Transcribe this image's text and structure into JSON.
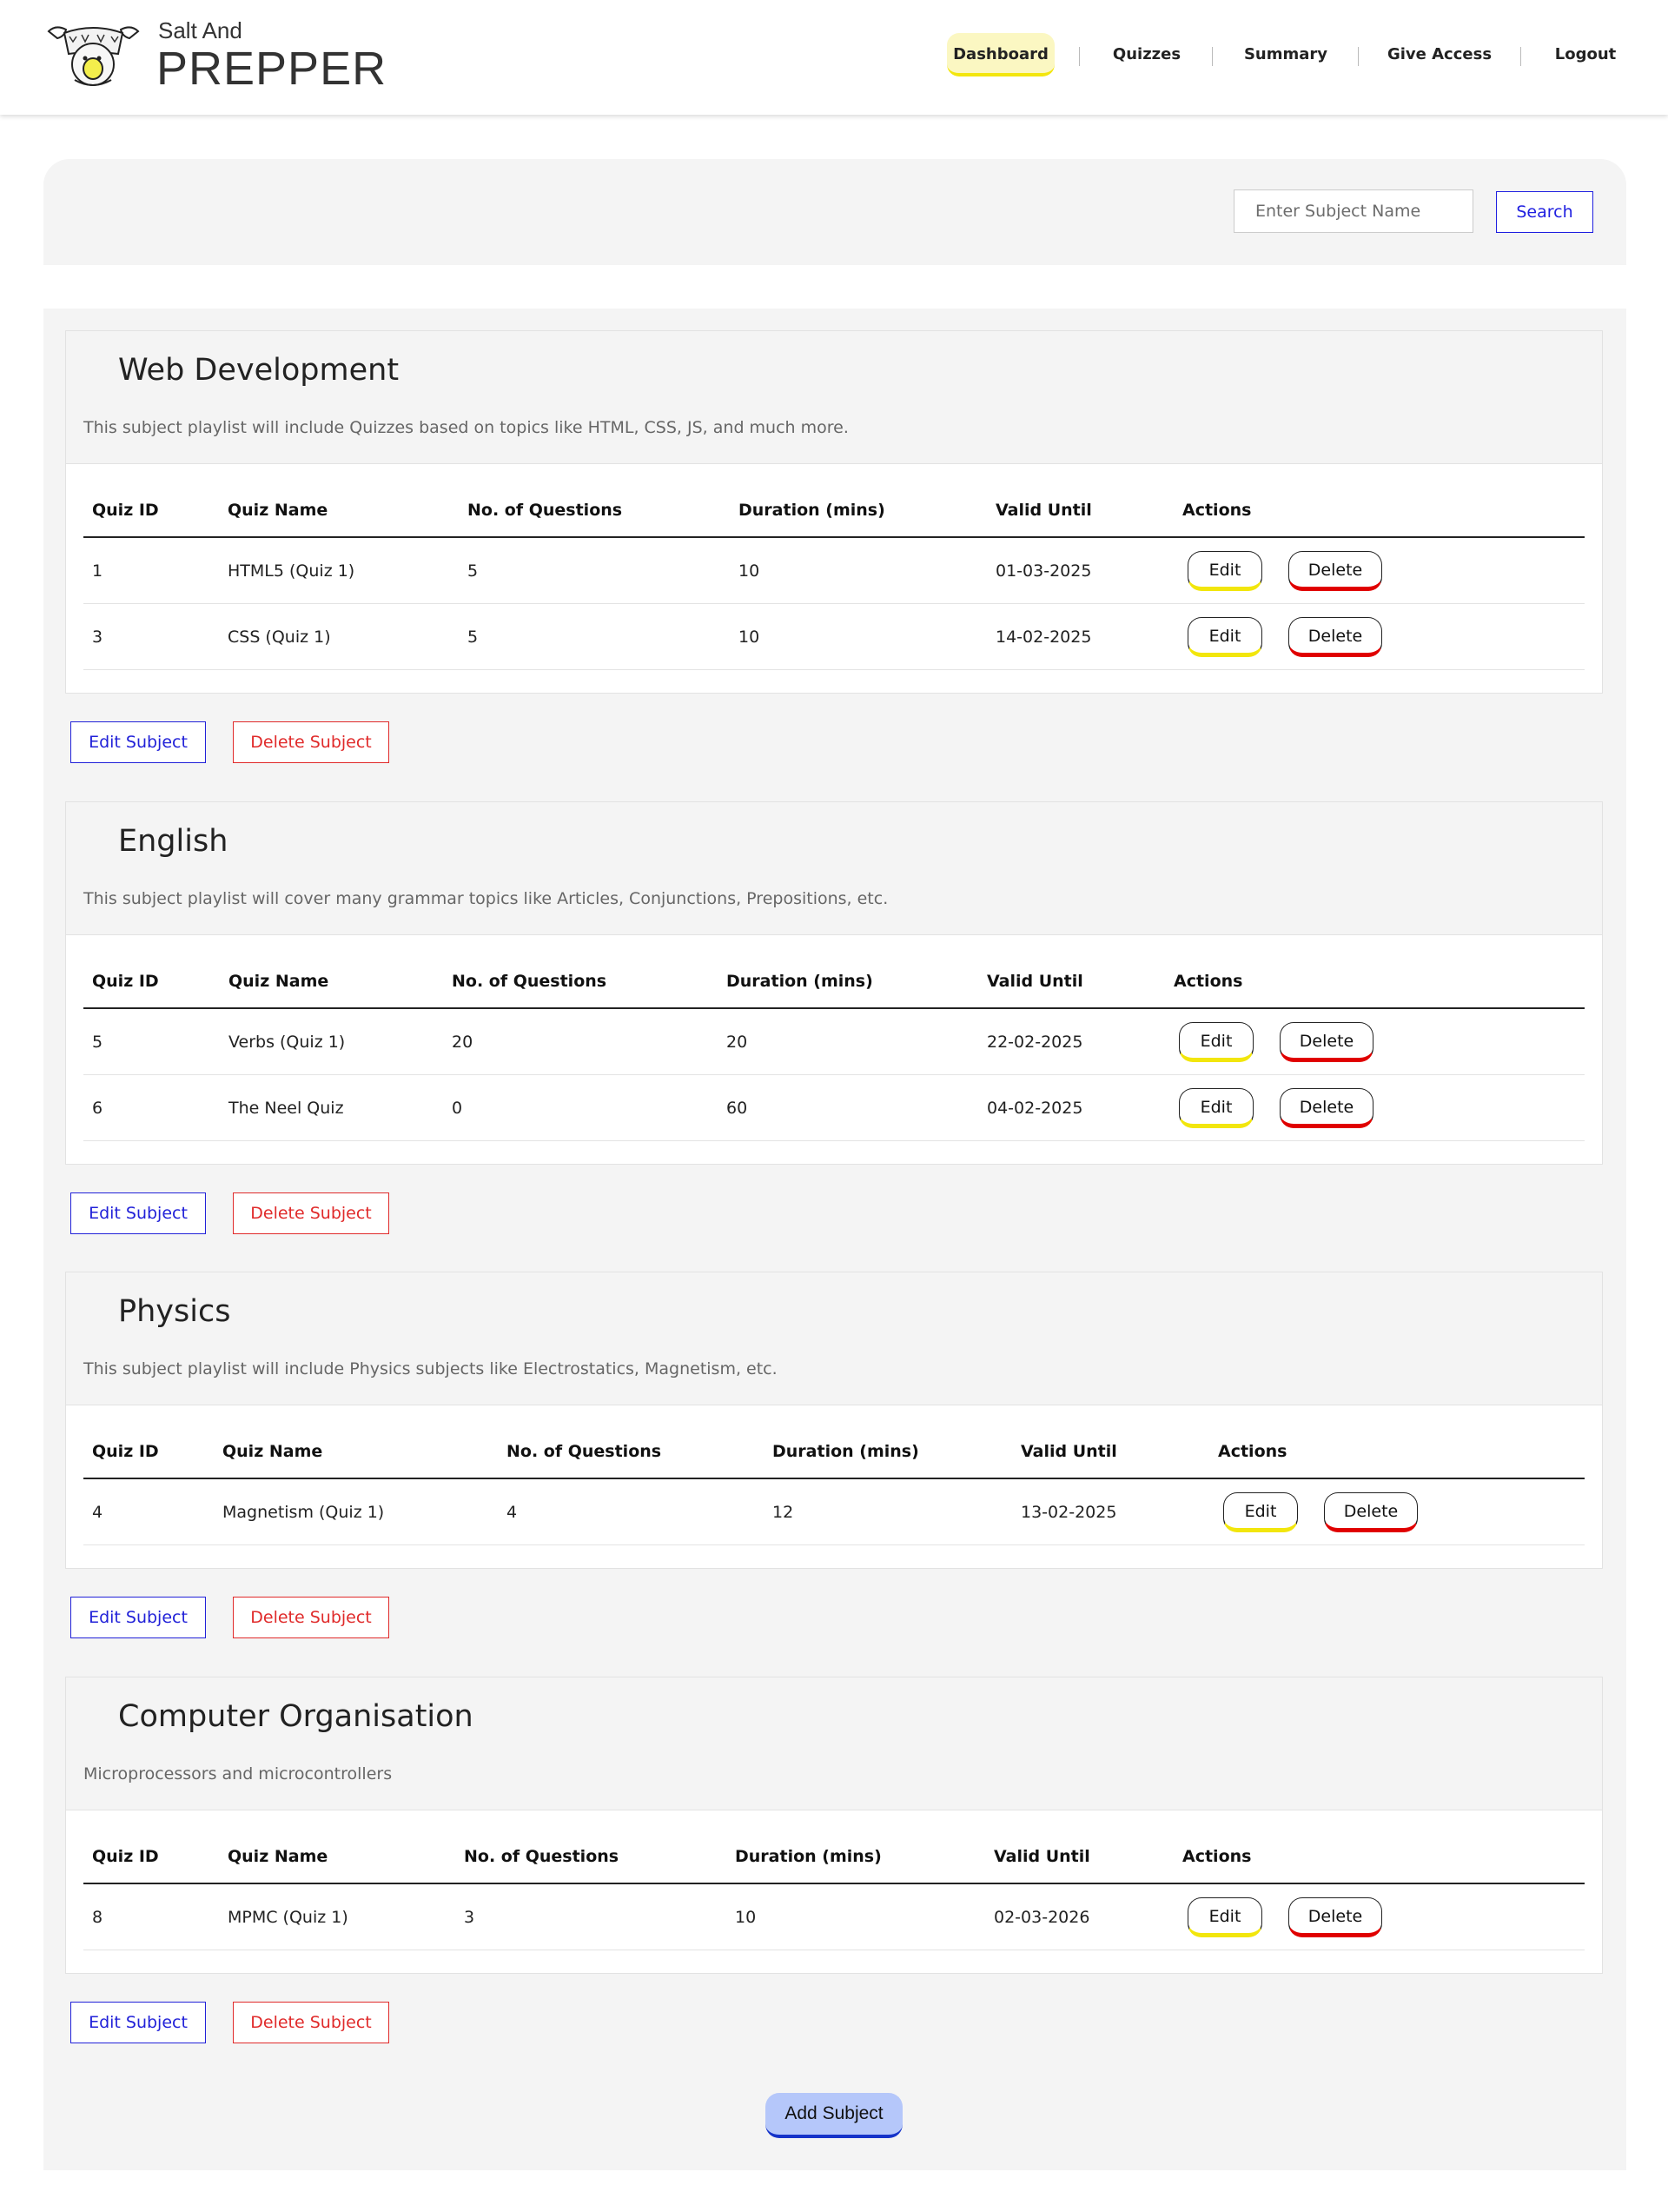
{
  "brand": {
    "line1": "Salt And",
    "line2": "PREPPER",
    "logo_icon": "salt-shaker-logo-icon"
  },
  "nav": {
    "items": [
      {
        "label": "Dashboard",
        "active": true
      },
      {
        "label": "Quizzes",
        "active": false
      },
      {
        "label": "Summary",
        "active": false
      },
      {
        "label": "Give Access",
        "active": false
      },
      {
        "label": "Logout",
        "active": false
      }
    ]
  },
  "search": {
    "placeholder": "Enter Subject Name",
    "value": "",
    "button_label": "Search"
  },
  "table_headers": [
    "Quiz ID",
    "Quiz Name",
    "No. of Questions",
    "Duration (mins)",
    "Valid Until",
    "Actions"
  ],
  "row_actions": {
    "edit": "Edit",
    "delete": "Delete"
  },
  "subject_actions": {
    "edit": "Edit Subject",
    "delete": "Delete Subject"
  },
  "subjects": [
    {
      "name": "Web Development",
      "description": "This subject playlist will include Quizzes based on topics like HTML, CSS, JS, and much more.",
      "quizzes": [
        {
          "id": "1",
          "name": "HTML5 (Quiz 1)",
          "questions": "5",
          "duration": "10",
          "valid_until": "01-03-2025"
        },
        {
          "id": "3",
          "name": "CSS (Quiz 1)",
          "questions": "5",
          "duration": "10",
          "valid_until": "14-02-2025"
        }
      ]
    },
    {
      "name": "English",
      "description": "This subject playlist will cover many grammar topics like Articles, Conjunctions, Prepositions, etc.",
      "quizzes": [
        {
          "id": "5",
          "name": "Verbs (Quiz 1)",
          "questions": "20",
          "duration": "20",
          "valid_until": "22-02-2025"
        },
        {
          "id": "6",
          "name": "The Neel Quiz",
          "questions": "0",
          "duration": "60",
          "valid_until": "04-02-2025"
        }
      ]
    },
    {
      "name": "Physics",
      "description": "This subject playlist will include Physics subjects like Electrostatics, Magnetism, etc.",
      "quizzes": [
        {
          "id": "4",
          "name": "Magnetism (Quiz 1)",
          "questions": "4",
          "duration": "12",
          "valid_until": "13-02-2025"
        }
      ]
    },
    {
      "name": "Computer Organisation",
      "description": "Microprocessors and microcontrollers",
      "quizzes": [
        {
          "id": "8",
          "name": "MPMC (Quiz 1)",
          "questions": "3",
          "duration": "10",
          "valid_until": "02-03-2026"
        }
      ]
    }
  ],
  "add_subject_label": "Add Subject",
  "colors": {
    "nav_active_bg": "#fbf7c2",
    "nav_active_accent": "#f3e60e",
    "edit_accent": "#f2e60c",
    "delete_accent": "#e00000",
    "subject_edit": "#2121d8",
    "subject_delete": "#e02a2a",
    "add_subject_bg": "#b5c7fa",
    "add_subject_accent": "#1533c9",
    "panel_bg": "#f4f4f4"
  }
}
